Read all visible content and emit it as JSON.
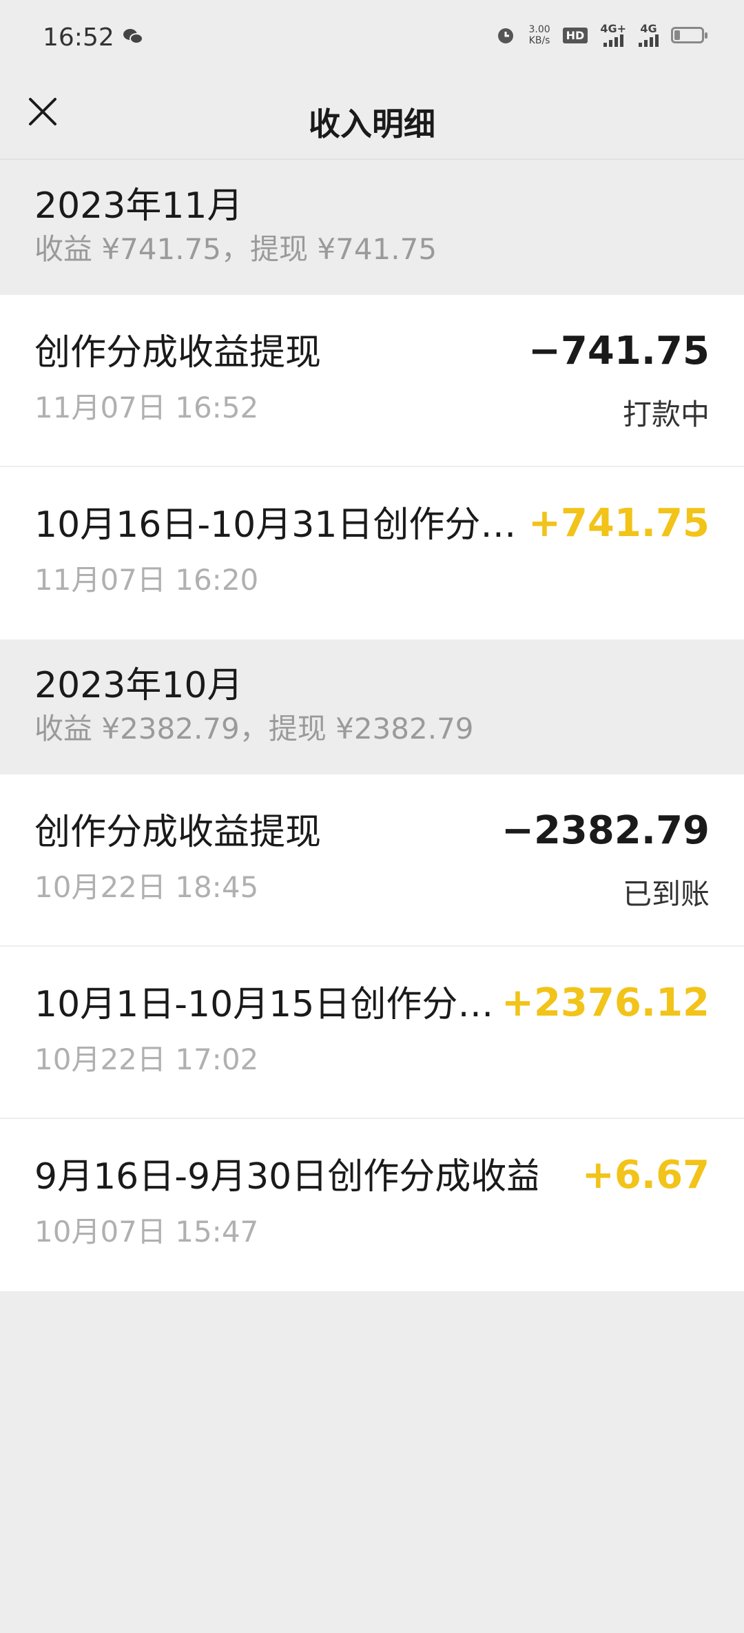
{
  "statusbar": {
    "time": "16:52",
    "speed_value": "3.00",
    "speed_unit": "KB/s",
    "hd_label": "HD",
    "net1": "4G+",
    "net2": "4G"
  },
  "navbar": {
    "title": "收入明细"
  },
  "colors": {
    "positive": "#f2c318",
    "negative": "#1a1a1a",
    "background": "#ededed"
  },
  "sections": [
    {
      "month": "2023年11月",
      "summary": "收益 ¥741.75，提现 ¥741.75",
      "items": [
        {
          "name": "创作分成收益提现",
          "date": "11月07日 16:52",
          "amount": "−741.75",
          "status": "打款中"
        },
        {
          "name": "10月16日-10月31日创作分…",
          "date": "11月07日 16:20",
          "amount": "+741.75"
        }
      ]
    },
    {
      "month": "2023年10月",
      "summary": "收益 ¥2382.79，提现 ¥2382.79",
      "items": [
        {
          "name": "创作分成收益提现",
          "date": "10月22日 18:45",
          "amount": "−2382.79",
          "status": "已到账"
        },
        {
          "name": "10月1日-10月15日创作分…",
          "date": "10月22日 17:02",
          "amount": "+2376.12"
        },
        {
          "name": "9月16日-9月30日创作分成收益",
          "date": "10月07日 15:47",
          "amount": "+6.67"
        }
      ]
    }
  ]
}
